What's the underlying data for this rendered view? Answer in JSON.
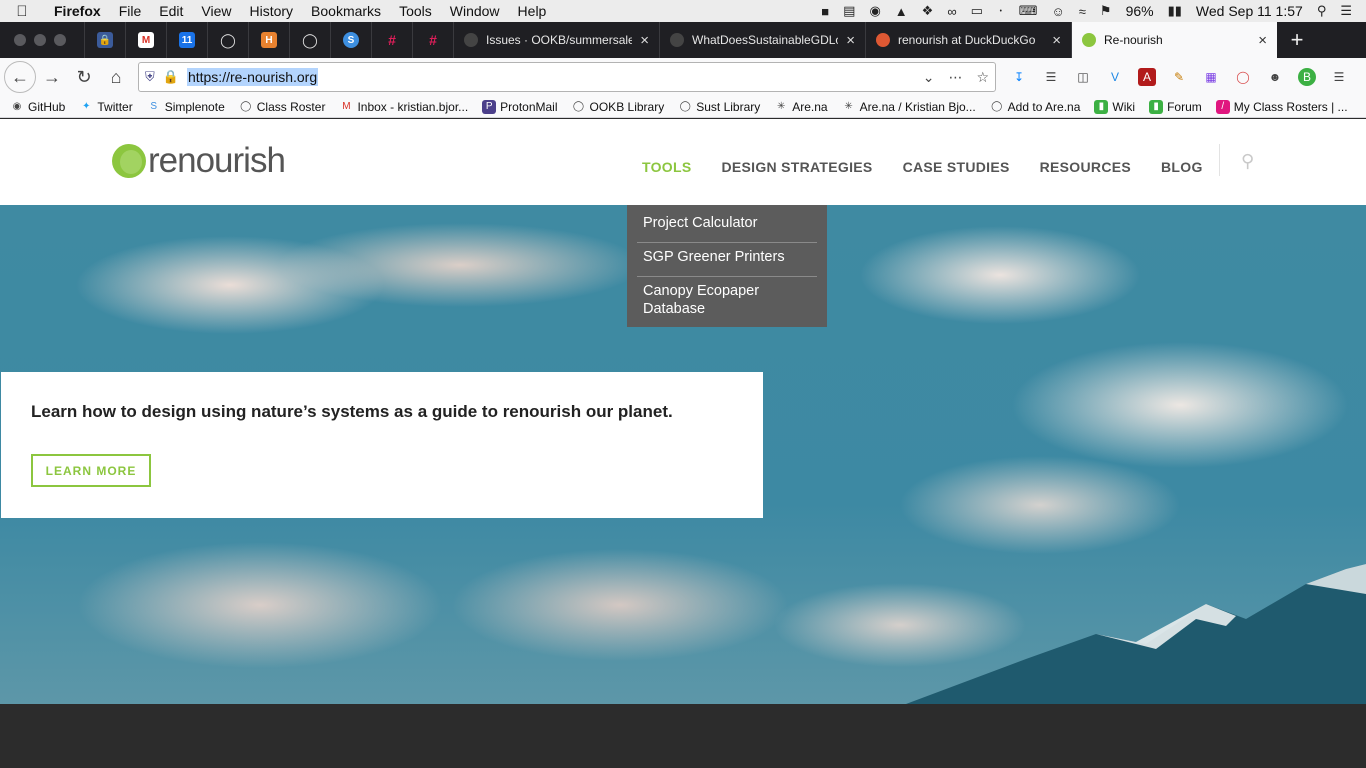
{
  "menubar": {
    "apple": "",
    "app": "Firefox",
    "items": [
      "File",
      "Edit",
      "View",
      "History",
      "Bookmarks",
      "Tools",
      "Window",
      "Help"
    ],
    "battery": "96%",
    "clock": "Wed Sep 11  1:57"
  },
  "tabs": {
    "pinned_icons": [
      "1password-icon",
      "gmail-icon",
      "calendar-icon",
      "globe-icon",
      "h-icon",
      "globe-icon",
      "simplenote-icon",
      "slack-icon",
      "slack-icon"
    ],
    "calendar_day": "11",
    "h_letter": "H",
    "items": [
      {
        "label": "Issues · OOKB/summersale",
        "favicon_color": "#24292e"
      },
      {
        "label": "WhatDoesSustainableGDLook",
        "favicon_color": "#24292e"
      },
      {
        "label": "renourish at DuckDuckGo",
        "favicon_color": "#de5833"
      },
      {
        "label": "Re-nourish",
        "favicon_color": "#8cc63f"
      }
    ],
    "new_tab": "+"
  },
  "navbar": {
    "url": "https://re-nourish.org"
  },
  "bookmarks": [
    {
      "label": "GitHub",
      "icon": "github-icon"
    },
    {
      "label": "Twitter",
      "icon": "twitter-icon"
    },
    {
      "label": "Simplenote",
      "icon": "simplenote-icon"
    },
    {
      "label": "Class Roster",
      "icon": "globe-icon"
    },
    {
      "label": "Inbox - kristian.bjor...",
      "icon": "gmail-icon"
    },
    {
      "label": "ProtonMail",
      "icon": "protonmail-icon"
    },
    {
      "label": "OOKB Library",
      "icon": "globe-icon"
    },
    {
      "label": "Sust Library",
      "icon": "globe-icon"
    },
    {
      "label": "Are.na",
      "icon": "arena-icon"
    },
    {
      "label": "Are.na / Kristian Bjo...",
      "icon": "arena-icon"
    },
    {
      "label": "Add to Are.na",
      "icon": "globe-icon"
    },
    {
      "label": "Wiki",
      "icon": "wiki-icon"
    },
    {
      "label": "Forum",
      "icon": "forum-icon"
    },
    {
      "label": "My Class Rosters | ...",
      "icon": "roster-icon"
    }
  ],
  "site": {
    "logo_text": "renourish",
    "nav": [
      "TOOLS",
      "DESIGN STRATEGIES",
      "CASE STUDIES",
      "RESOURCES",
      "BLOG"
    ],
    "dropdown": [
      "Project Calculator",
      "SGP Greener Printers",
      "Canopy Ecopaper Database"
    ],
    "hero_heading": "Learn how to design using nature’s systems as a guide to renourish our planet.",
    "cta": "LEARN MORE",
    "accent": "#8cc63f"
  }
}
